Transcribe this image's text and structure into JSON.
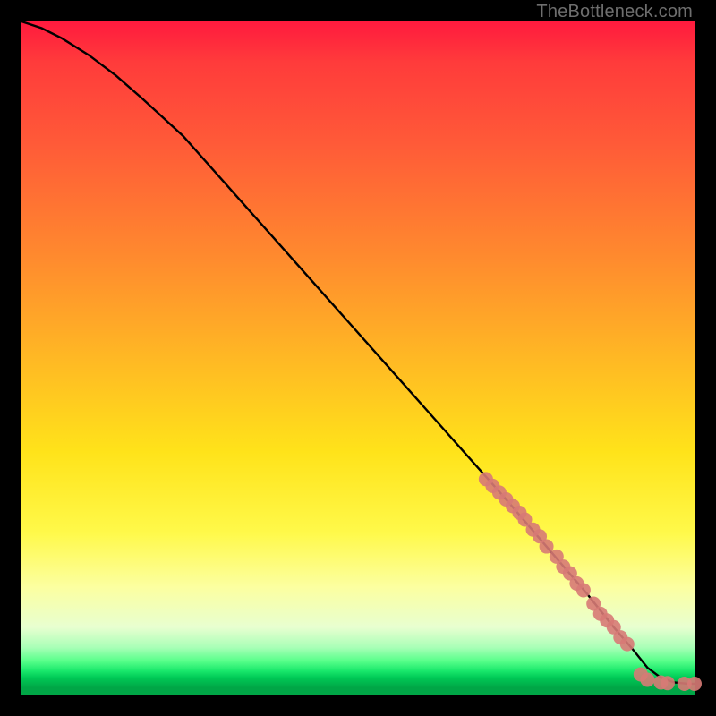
{
  "watermark": "TheBottleneck.com",
  "colors": {
    "background": "#000000",
    "curve": "#000000",
    "marker": "#d77a76",
    "gradient_top": "#ff1a3e",
    "gradient_bottom": "#00a646"
  },
  "chart_data": {
    "type": "line",
    "title": "",
    "xlabel": "",
    "ylabel": "",
    "xlim": [
      0,
      100
    ],
    "ylim": [
      0,
      100
    ],
    "grid": false,
    "legend": false,
    "series": [
      {
        "name": "curve",
        "x": [
          0,
          3,
          6,
          10,
          14,
          18,
          24,
          32,
          40,
          48,
          56,
          64,
          72,
          78,
          84,
          88,
          91,
          93,
          95,
          97,
          99,
          100
        ],
        "y": [
          100,
          99,
          97.5,
          95,
          92,
          88.5,
          83,
          74,
          65,
          56,
          47,
          38,
          29,
          22,
          15,
          10,
          6.5,
          4,
          2.5,
          1.8,
          1.6,
          1.6
        ]
      }
    ],
    "markers": [
      {
        "name": "diag-cluster",
        "points": [
          {
            "x": 69,
            "y": 32
          },
          {
            "x": 70,
            "y": 31
          },
          {
            "x": 71,
            "y": 30
          },
          {
            "x": 72,
            "y": 29
          },
          {
            "x": 73,
            "y": 28
          },
          {
            "x": 74,
            "y": 27
          },
          {
            "x": 74.8,
            "y": 26
          },
          {
            "x": 76,
            "y": 24.5
          },
          {
            "x": 77,
            "y": 23.5
          },
          {
            "x": 78,
            "y": 22
          },
          {
            "x": 79.5,
            "y": 20.5
          },
          {
            "x": 80.5,
            "y": 19
          },
          {
            "x": 81.5,
            "y": 18
          },
          {
            "x": 82.5,
            "y": 16.5
          },
          {
            "x": 83.5,
            "y": 15.5
          },
          {
            "x": 85,
            "y": 13.5
          },
          {
            "x": 86,
            "y": 12
          },
          {
            "x": 87,
            "y": 11
          },
          {
            "x": 88,
            "y": 10
          },
          {
            "x": 89,
            "y": 8.5
          },
          {
            "x": 90,
            "y": 7.5
          }
        ]
      },
      {
        "name": "tail-cluster",
        "points": [
          {
            "x": 92,
            "y": 3
          },
          {
            "x": 93,
            "y": 2.2
          },
          {
            "x": 95,
            "y": 1.8
          },
          {
            "x": 96,
            "y": 1.7
          },
          {
            "x": 98.5,
            "y": 1.6
          },
          {
            "x": 100,
            "y": 1.6
          }
        ]
      }
    ]
  }
}
